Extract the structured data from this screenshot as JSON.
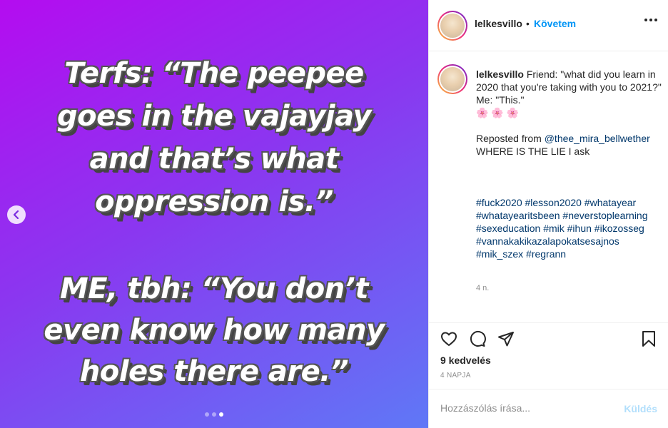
{
  "post": {
    "meme_lines": [
      "Terfs: “The peepee",
      "goes in the vajayjay",
      "and that’s what",
      "oppression is.”",
      "ME, tbh: “You don’t",
      "even know how many",
      "holes there are.”"
    ],
    "carousel": {
      "count": 3,
      "active_index": 2
    },
    "background_colors": [
      "#b40cf0",
      "#8b36f0",
      "#5f78f6"
    ]
  },
  "header": {
    "username": "lelkesvillo",
    "separator": "•",
    "follow_label": "Követem",
    "more_icon": "more-dots-icon"
  },
  "caption": {
    "username": "lelkesvillo",
    "text_line1": "Friend: \"what did you learn in 2020 that you're taking with you to 2021?\"",
    "text_line2": "Me: \"This.\"",
    "emojis": "🌸 🌸 🌸",
    "repost_prefix": "Reposted from ",
    "repost_user": "@thee_mira_bellwether",
    "repost_note": "WHERE IS THE LIE I ask",
    "hashtags": [
      "#fuck2020",
      "#lesson2020",
      "#whatayear",
      "#whatayearitsbeen",
      "#neverstoplearning",
      "#sexeducation",
      "#mik",
      "#ihun",
      "#ikozosseg",
      "#vannakakikazalapokatsesajnos",
      "#mik_szex",
      "#regrann"
    ],
    "time": "4 n."
  },
  "actions": {
    "like_icon": "heart-icon",
    "comment_icon": "comment-icon",
    "share_icon": "share-icon",
    "save_icon": "bookmark-icon"
  },
  "likes": "9 kedvelés",
  "post_age": "4 NAPJA",
  "comment": {
    "placeholder": "Hozzászólás írása...",
    "send_label": "Küldés"
  },
  "colors": {
    "link_blue": "#0095f6",
    "hashtag": "#00376b",
    "send_disabled": "#b2dffc",
    "muted": "#8e8e8e"
  }
}
